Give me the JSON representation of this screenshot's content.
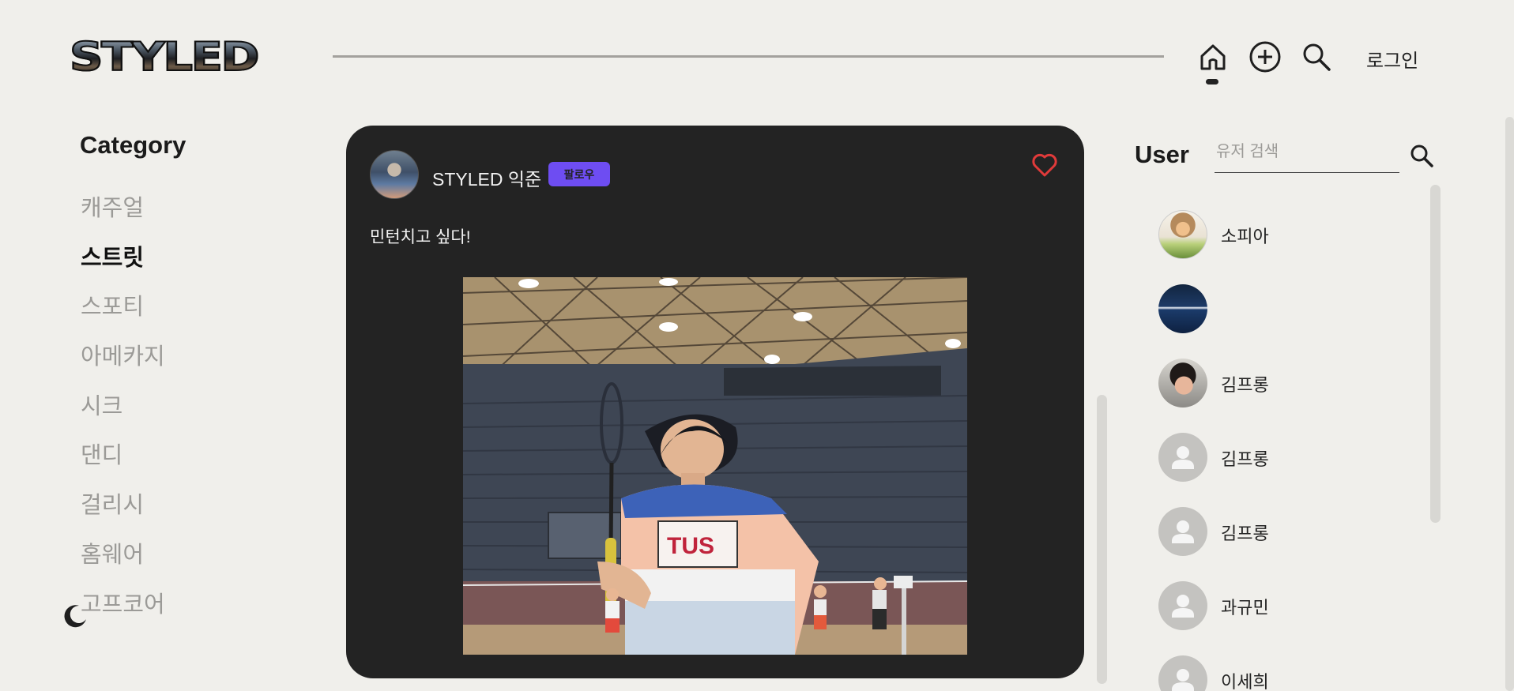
{
  "header": {
    "logo_text": "STYLED",
    "login_label": "로그인",
    "icons": [
      "home-icon",
      "add-circle-icon",
      "search-icon"
    ]
  },
  "sidebar": {
    "title": "Category",
    "items": [
      {
        "label": "캐주얼",
        "active": false
      },
      {
        "label": "스트릿",
        "active": true
      },
      {
        "label": "스포티",
        "active": false
      },
      {
        "label": "아메카지",
        "active": false
      },
      {
        "label": "시크",
        "active": false
      },
      {
        "label": "댄디",
        "active": false
      },
      {
        "label": "걸리시",
        "active": false
      },
      {
        "label": "홈웨어",
        "active": false
      },
      {
        "label": "고프코어",
        "active": false
      }
    ],
    "theme_toggle_icon": "moon-icon"
  },
  "post": {
    "author": "STYLED 익준",
    "follow_label": "팔로우",
    "text": "민턴치고 싶다!",
    "like_icon": "heart-outline-icon",
    "like_color": "#e03a3a"
  },
  "users": {
    "title": "User",
    "search_placeholder": "유저 검색",
    "list": [
      {
        "name": "소피아",
        "avatar": "photo"
      },
      {
        "name": "",
        "avatar": "photo"
      },
      {
        "name": "김프롱",
        "avatar": "photo"
      },
      {
        "name": "김프롱",
        "avatar": "default-person-icon"
      },
      {
        "name": "김프롱",
        "avatar": "default-person-icon"
      },
      {
        "name": "과규민",
        "avatar": "default-person-icon"
      },
      {
        "name": "이세희",
        "avatar": "default-person-icon"
      }
    ]
  },
  "colors": {
    "background": "#f0efeb",
    "card": "#232323",
    "follow_button": "#6e4df2",
    "muted_text": "#9b9a97"
  }
}
